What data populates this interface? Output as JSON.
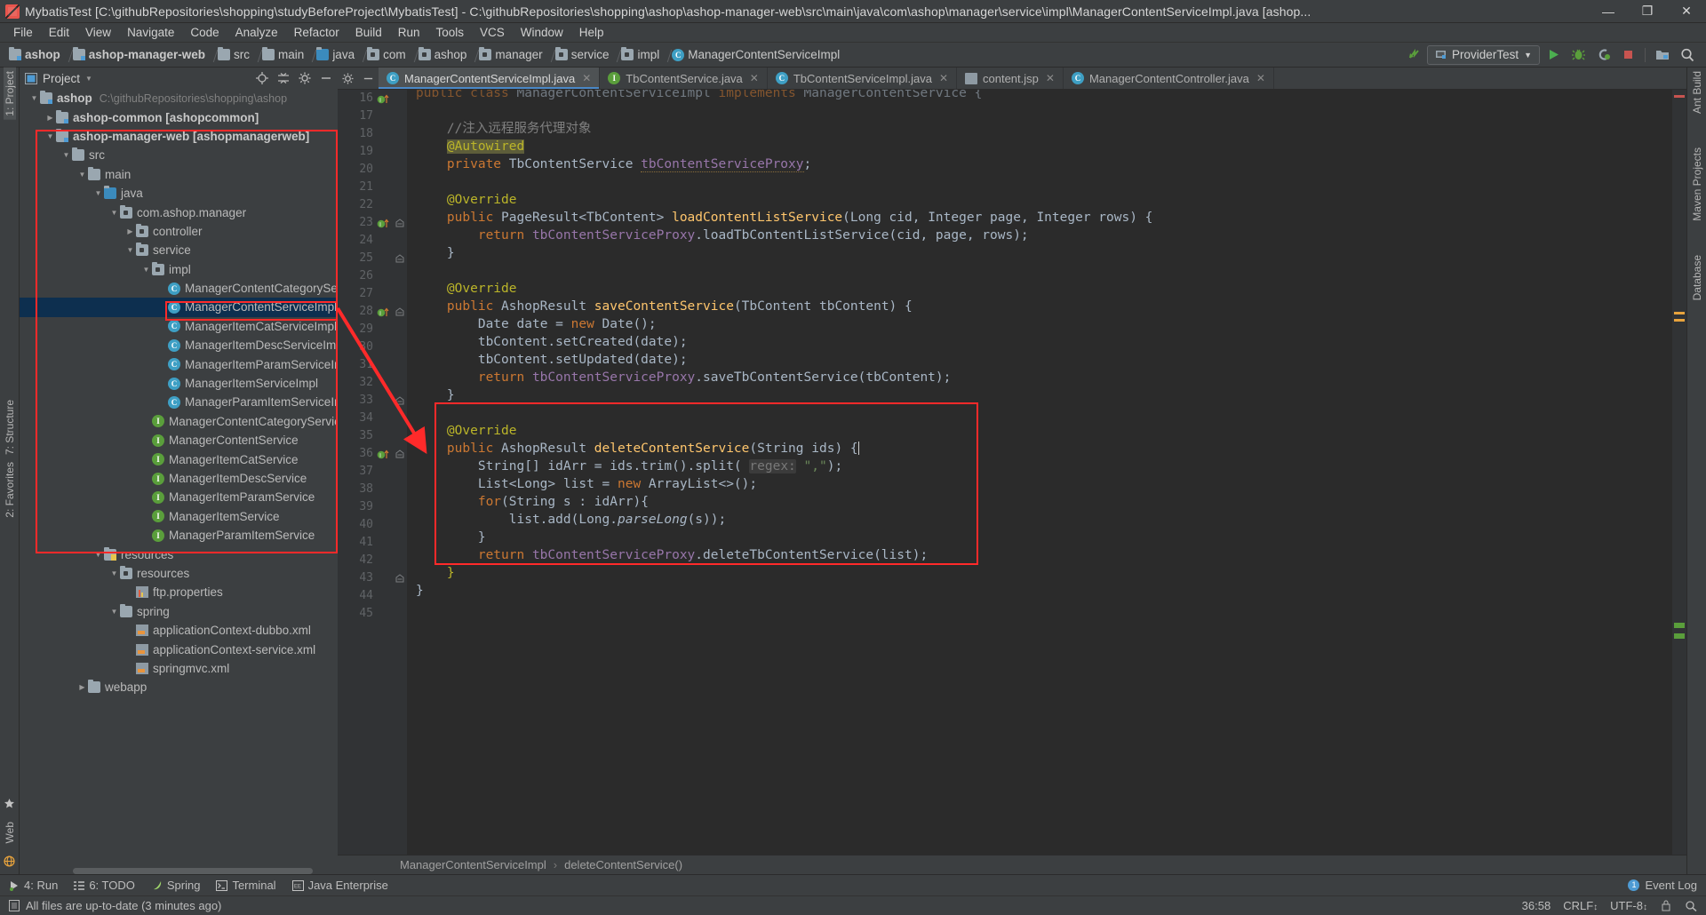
{
  "window": {
    "title": "MybatisTest [C:\\githubRepositories\\shopping\\studyBeforeProject\\MybatisTest] - C:\\githubRepositories\\shopping\\ashop\\ashop-manager-web\\src\\main\\java\\com\\ashop\\manager\\service\\impl\\ManagerContentServiceImpl.java [ashop...",
    "minimize": "—",
    "maximize": "❐",
    "close": "✕"
  },
  "menubar": {
    "items": [
      "File",
      "Edit",
      "View",
      "Navigate",
      "Code",
      "Analyze",
      "Refactor",
      "Build",
      "Run",
      "Tools",
      "VCS",
      "Window",
      "Help"
    ]
  },
  "navbar": {
    "crumbs": [
      {
        "label": "ashop",
        "icon": "module-folder-icon",
        "bold": true
      },
      {
        "label": "ashop-manager-web",
        "icon": "module-folder-icon",
        "bold": true
      },
      {
        "label": "src",
        "icon": "folder-icon",
        "bold": false
      },
      {
        "label": "main",
        "icon": "folder-icon",
        "bold": false
      },
      {
        "label": "java",
        "icon": "source-folder-icon",
        "bold": false
      },
      {
        "label": "com",
        "icon": "package-icon",
        "bold": false
      },
      {
        "label": "ashop",
        "icon": "package-icon",
        "bold": false
      },
      {
        "label": "manager",
        "icon": "package-icon",
        "bold": false
      },
      {
        "label": "service",
        "icon": "package-icon",
        "bold": false
      },
      {
        "label": "impl",
        "icon": "package-icon",
        "bold": false
      },
      {
        "label": "ManagerContentServiceImpl",
        "icon": "class-icon",
        "bold": false
      }
    ],
    "run_config": "ProviderTest",
    "run_config_caret": "▼",
    "buttons": [
      "run-button",
      "debug-button",
      "coverage-button",
      "stop-button",
      "project-structure-button",
      "search-everywhere-button"
    ]
  },
  "left_strip": {
    "top": "1: Project",
    "middle": "7: Structure",
    "bottom": "2: Favorites",
    "web": "Web"
  },
  "right_strip": {
    "top": "Ant Build",
    "middle": "Maven Projects",
    "bottom": "Database"
  },
  "project_panel": {
    "title": "Project",
    "caret": "▼",
    "tree": [
      {
        "depth": 0,
        "arrow": "open",
        "icon": "module-folder-icon",
        "label": "ashop",
        "bold": true,
        "path": "C:\\githubRepositories\\shopping\\ashop"
      },
      {
        "depth": 1,
        "arrow": "closed",
        "icon": "module-folder-icon",
        "label": "ashop-common [ashopcommon]",
        "bold": true,
        "path": ""
      },
      {
        "depth": 1,
        "arrow": "open",
        "icon": "module-folder-icon",
        "label": "ashop-manager-web [ashopmanagerweb]",
        "bold": true,
        "path": ""
      },
      {
        "depth": 2,
        "arrow": "open",
        "icon": "folder-icon",
        "label": "src",
        "bold": false,
        "path": ""
      },
      {
        "depth": 3,
        "arrow": "open",
        "icon": "folder-icon",
        "label": "main",
        "bold": false,
        "path": ""
      },
      {
        "depth": 4,
        "arrow": "open",
        "icon": "source-folder-icon",
        "label": "java",
        "bold": false,
        "path": ""
      },
      {
        "depth": 5,
        "arrow": "open",
        "icon": "package-icon",
        "label": "com.ashop.manager",
        "bold": false,
        "path": ""
      },
      {
        "depth": 6,
        "arrow": "closed",
        "icon": "package-icon",
        "label": "controller",
        "bold": false,
        "path": ""
      },
      {
        "depth": 6,
        "arrow": "open",
        "icon": "package-icon",
        "label": "service",
        "bold": false,
        "path": ""
      },
      {
        "depth": 7,
        "arrow": "open",
        "icon": "package-icon",
        "label": "impl",
        "bold": false,
        "path": ""
      },
      {
        "depth": 8,
        "arrow": "none",
        "icon": "class-icon",
        "label": "ManagerContentCategoryServiceImpl",
        "bold": false,
        "path": ""
      },
      {
        "depth": 8,
        "arrow": "none",
        "icon": "class-icon",
        "label": "ManagerContentServiceImpl",
        "bold": false,
        "path": "",
        "selected": true
      },
      {
        "depth": 8,
        "arrow": "none",
        "icon": "class-icon",
        "label": "ManagerItemCatServiceImpl",
        "bold": false,
        "path": ""
      },
      {
        "depth": 8,
        "arrow": "none",
        "icon": "class-icon",
        "label": "ManagerItemDescServiceImpl",
        "bold": false,
        "path": ""
      },
      {
        "depth": 8,
        "arrow": "none",
        "icon": "class-icon",
        "label": "ManagerItemParamServiceImpl",
        "bold": false,
        "path": ""
      },
      {
        "depth": 8,
        "arrow": "none",
        "icon": "class-icon",
        "label": "ManagerItemServiceImpl",
        "bold": false,
        "path": ""
      },
      {
        "depth": 8,
        "arrow": "none",
        "icon": "class-icon",
        "label": "ManagerParamItemServiceImpl",
        "bold": false,
        "path": ""
      },
      {
        "depth": 7,
        "arrow": "none",
        "icon": "interface-icon",
        "label": "ManagerContentCategoryService",
        "bold": false,
        "path": ""
      },
      {
        "depth": 7,
        "arrow": "none",
        "icon": "interface-icon",
        "label": "ManagerContentService",
        "bold": false,
        "path": ""
      },
      {
        "depth": 7,
        "arrow": "none",
        "icon": "interface-icon",
        "label": "ManagerItemCatService",
        "bold": false,
        "path": ""
      },
      {
        "depth": 7,
        "arrow": "none",
        "icon": "interface-icon",
        "label": "ManagerItemDescService",
        "bold": false,
        "path": ""
      },
      {
        "depth": 7,
        "arrow": "none",
        "icon": "interface-icon",
        "label": "ManagerItemParamService",
        "bold": false,
        "path": ""
      },
      {
        "depth": 7,
        "arrow": "none",
        "icon": "interface-icon",
        "label": "ManagerItemService",
        "bold": false,
        "path": ""
      },
      {
        "depth": 7,
        "arrow": "none",
        "icon": "interface-icon",
        "label": "ManagerParamItemService",
        "bold": false,
        "path": ""
      },
      {
        "depth": 4,
        "arrow": "open",
        "icon": "resource-folder-icon",
        "label": "resources",
        "bold": false,
        "path": ""
      },
      {
        "depth": 5,
        "arrow": "open",
        "icon": "package-icon",
        "label": "resources",
        "bold": false,
        "path": ""
      },
      {
        "depth": 6,
        "arrow": "none",
        "icon": "properties-icon",
        "label": "ftp.properties",
        "bold": false,
        "path": ""
      },
      {
        "depth": 5,
        "arrow": "open",
        "icon": "folder-icon",
        "label": "spring",
        "bold": false,
        "path": ""
      },
      {
        "depth": 6,
        "arrow": "none",
        "icon": "xml-icon",
        "label": "applicationContext-dubbo.xml",
        "bold": false,
        "path": ""
      },
      {
        "depth": 6,
        "arrow": "none",
        "icon": "xml-icon",
        "label": "applicationContext-service.xml",
        "bold": false,
        "path": ""
      },
      {
        "depth": 6,
        "arrow": "none",
        "icon": "xml-icon",
        "label": "springmvc.xml",
        "bold": false,
        "path": ""
      },
      {
        "depth": 3,
        "arrow": "closed",
        "icon": "folder-icon",
        "label": "webapp",
        "bold": false,
        "path": ""
      }
    ]
  },
  "editor": {
    "tabs": [
      {
        "label": "ManagerContentServiceImpl.java",
        "icon": "class-icon",
        "active": true,
        "close": "✕"
      },
      {
        "label": "TbContentService.java",
        "icon": "interface-icon",
        "active": false,
        "close": "✕"
      },
      {
        "label": "TbContentServiceImpl.java",
        "icon": "class-icon",
        "active": false,
        "close": "✕"
      },
      {
        "label": "content.jsp",
        "icon": "jsp-icon",
        "active": false,
        "close": "✕"
      },
      {
        "label": "ManagerContentController.java",
        "icon": "class-icon",
        "active": false,
        "close": "✕"
      }
    ],
    "first_line_number": 16,
    "lines": [
      {
        "n": 16,
        "tokens": [
          {
            "t": "public ",
            "c": "kw"
          },
          {
            "t": "class ",
            "c": "kw"
          },
          {
            "t": "ManagerContentServiceImpl ",
            "c": "cls-t"
          },
          {
            "t": "implements ",
            "c": "kw"
          },
          {
            "t": "ManagerContentService {",
            "c": "cls-t"
          }
        ],
        "indent": 0,
        "mark": "class-icon",
        "clipped": true
      },
      {
        "n": 17,
        "tokens": [],
        "indent": 0
      },
      {
        "n": 18,
        "tokens": [
          {
            "t": "//注入远程服务代理对象",
            "c": "cm"
          }
        ],
        "indent": 4
      },
      {
        "n": 19,
        "tokens": [
          {
            "t": "@Autowired",
            "c": "an-hl"
          }
        ],
        "indent": 4
      },
      {
        "n": 20,
        "tokens": [
          {
            "t": "private ",
            "c": "kw"
          },
          {
            "t": "TbContentService ",
            "c": "cls-t"
          },
          {
            "t": "tbContentServiceProxy",
            "c": "fld-u"
          },
          {
            "t": ";",
            "c": "cls-t"
          }
        ],
        "indent": 4
      },
      {
        "n": 21,
        "tokens": [],
        "indent": 0
      },
      {
        "n": 22,
        "tokens": [
          {
            "t": "@Override",
            "c": "an"
          }
        ],
        "indent": 4
      },
      {
        "n": 23,
        "tokens": [
          {
            "t": "public ",
            "c": "kw"
          },
          {
            "t": "PageResult<TbContent> ",
            "c": "cls-t"
          },
          {
            "t": "loadContentListService",
            "c": "fn"
          },
          {
            "t": "(",
            "c": "cls-t"
          },
          {
            "t": "Long ",
            "c": "cls-t"
          },
          {
            "t": "cid, ",
            "c": "cls-t"
          },
          {
            "t": "Integer ",
            "c": "cls-t"
          },
          {
            "t": "page, ",
            "c": "cls-t"
          },
          {
            "t": "Integer ",
            "c": "cls-t"
          },
          {
            "t": "rows) {",
            "c": "cls-t"
          }
        ],
        "indent": 4,
        "mark": "override-impl-icon",
        "fold": "⊖"
      },
      {
        "n": 24,
        "tokens": [
          {
            "t": "return ",
            "c": "kw"
          },
          {
            "t": "tbContentServiceProxy",
            "c": "fld"
          },
          {
            "t": ".loadTbContentListService(cid, page, rows);",
            "c": "cls-t"
          }
        ],
        "indent": 8
      },
      {
        "n": 25,
        "tokens": [
          {
            "t": "}",
            "c": "cls-t"
          }
        ],
        "indent": 4,
        "fold": "⊖"
      },
      {
        "n": 26,
        "tokens": [],
        "indent": 0
      },
      {
        "n": 27,
        "tokens": [
          {
            "t": "@Override",
            "c": "an"
          }
        ],
        "indent": 4
      },
      {
        "n": 28,
        "tokens": [
          {
            "t": "public ",
            "c": "kw"
          },
          {
            "t": "AshopResult ",
            "c": "cls-t"
          },
          {
            "t": "saveContentService",
            "c": "fn"
          },
          {
            "t": "(",
            "c": "cls-t"
          },
          {
            "t": "TbContent ",
            "c": "cls-t"
          },
          {
            "t": "tbContent) {",
            "c": "cls-t"
          }
        ],
        "indent": 4,
        "mark": "override-impl-icon",
        "fold": "⊖"
      },
      {
        "n": 29,
        "tokens": [
          {
            "t": "Date ",
            "c": "cls-t"
          },
          {
            "t": "date = ",
            "c": "cls-t"
          },
          {
            "t": "new ",
            "c": "kw"
          },
          {
            "t": "Date();",
            "c": "cls-t"
          }
        ],
        "indent": 8
      },
      {
        "n": 30,
        "tokens": [
          {
            "t": "tbContent.setCreated(date);",
            "c": "cls-t"
          }
        ],
        "indent": 8
      },
      {
        "n": 31,
        "tokens": [
          {
            "t": "tbContent.setUpdated(date);",
            "c": "cls-t"
          }
        ],
        "indent": 8
      },
      {
        "n": 32,
        "tokens": [
          {
            "t": "return ",
            "c": "kw"
          },
          {
            "t": "tbContentServiceProxy",
            "c": "fld"
          },
          {
            "t": ".saveTbContentService(tbContent);",
            "c": "cls-t"
          }
        ],
        "indent": 8
      },
      {
        "n": 33,
        "tokens": [
          {
            "t": "}",
            "c": "cls-t"
          }
        ],
        "indent": 4,
        "fold": "⊖"
      },
      {
        "n": 34,
        "tokens": [],
        "indent": 0
      },
      {
        "n": 35,
        "tokens": [
          {
            "t": "@Override",
            "c": "an"
          }
        ],
        "indent": 4
      },
      {
        "n": 36,
        "tokens": [
          {
            "t": "public ",
            "c": "kw"
          },
          {
            "t": "AshopResult ",
            "c": "cls-t"
          },
          {
            "t": "deleteContentService",
            "c": "fn"
          },
          {
            "t": "(",
            "c": "cls-t"
          },
          {
            "t": "String ",
            "c": "cls-t"
          },
          {
            "t": "ids) {",
            "c": "cls-t"
          }
        ],
        "indent": 4,
        "mark": "override-impl-icon",
        "fold": "⊖",
        "caret": true
      },
      {
        "n": 37,
        "tokens": [
          {
            "t": "String[] ",
            "c": "cls-t"
          },
          {
            "t": "idArr = ids.trim().split( ",
            "c": "cls-t"
          },
          {
            "t": "regex:",
            "c": "hint"
          },
          {
            "t": " ",
            "c": "cls-t"
          },
          {
            "t": "\",\"",
            "c": "str"
          },
          {
            "t": ");",
            "c": "cls-t"
          }
        ],
        "indent": 8
      },
      {
        "n": 38,
        "tokens": [
          {
            "t": "List<Long> ",
            "c": "cls-t"
          },
          {
            "t": "list = ",
            "c": "cls-t"
          },
          {
            "t": "new ",
            "c": "kw"
          },
          {
            "t": "ArrayList<>();",
            "c": "cls-t"
          }
        ],
        "indent": 8
      },
      {
        "n": 39,
        "tokens": [
          {
            "t": "for",
            "c": "kw"
          },
          {
            "t": "(",
            "c": "cls-t"
          },
          {
            "t": "String ",
            "c": "cls-t"
          },
          {
            "t": "s : idArr){",
            "c": "cls-t"
          }
        ],
        "indent": 8
      },
      {
        "n": 40,
        "tokens": [
          {
            "t": "list.add(Long.",
            "c": "cls-t"
          },
          {
            "t": "parseLong",
            "c": "ital"
          },
          {
            "t": "(s));",
            "c": "cls-t"
          }
        ],
        "indent": 12
      },
      {
        "n": 41,
        "tokens": [
          {
            "t": "}",
            "c": "cls-t"
          }
        ],
        "indent": 8
      },
      {
        "n": 42,
        "tokens": [
          {
            "t": "return ",
            "c": "kw"
          },
          {
            "t": "tbContentServiceProxy",
            "c": "fld"
          },
          {
            "t": ".deleteTbContentService(list);",
            "c": "cls-t"
          }
        ],
        "indent": 8
      },
      {
        "n": 43,
        "tokens": [
          {
            "t": "}",
            "c": "an"
          }
        ],
        "indent": 4,
        "fold": "⊖"
      },
      {
        "n": 44,
        "tokens": [
          {
            "t": "}",
            "c": "cls-t"
          }
        ],
        "indent": 0
      },
      {
        "n": 45,
        "tokens": [],
        "indent": 0
      }
    ],
    "breadcrumb": {
      "class": "ManagerContentServiceImpl",
      "separator": "›",
      "method": "deleteContentService()"
    }
  },
  "bottom_tools": [
    {
      "label": "4: Run",
      "mnemonic": "4",
      "icon": "run-icon"
    },
    {
      "label": "6: TODO",
      "mnemonic": "6",
      "icon": "todo-icon"
    },
    {
      "label": "Spring",
      "mnemonic": "",
      "icon": "spring-icon"
    },
    {
      "label": "Terminal",
      "mnemonic": "",
      "icon": "terminal-icon"
    },
    {
      "label": "Java Enterprise",
      "mnemonic": "",
      "icon": "java-enterprise-icon"
    }
  ],
  "event_log": {
    "label": "Event Log",
    "badge": "1"
  },
  "statusbar": {
    "message": "All files are up-to-date (3 minutes ago)",
    "caret_position": "36:58",
    "line_separator": "CRLF",
    "encoding": "UTF-8",
    "separator_caret": "↕",
    "encoding_caret": "↕"
  },
  "colors": {
    "accent": "#4a88c7",
    "annotation_red": "#ff2a2a",
    "keyword": "#cc7832",
    "annotation_yellow": "#bbb529",
    "string": "#6a8759",
    "field": "#9876aa",
    "method": "#ffc66d",
    "editor_bg": "#2b2b2b",
    "panel_bg": "#3c3f41"
  }
}
